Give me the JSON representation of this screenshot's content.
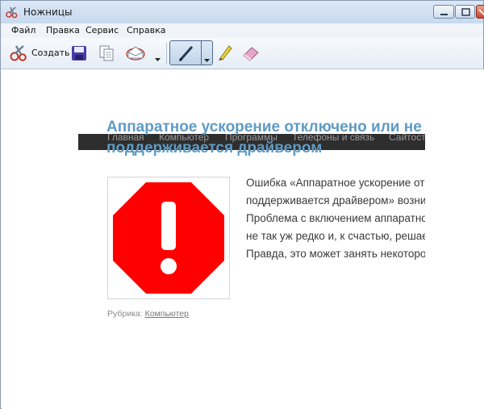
{
  "window": {
    "title": "Ножницы",
    "controls": {
      "minimize": "minimize",
      "maximize": "maximize",
      "close": "close"
    }
  },
  "menu": {
    "items": [
      "Файл",
      "Правка",
      "Сервис",
      "Справка"
    ]
  },
  "toolbar": {
    "new_label": "Создать",
    "icons": [
      "scissors-icon",
      "save-icon",
      "copy-icon",
      "send-email-icon",
      "pen-icon",
      "highlighter-icon",
      "eraser-icon"
    ]
  },
  "snip": {
    "nav": [
      "Главная",
      "Компьютер",
      "Программы",
      "Телефоны и связь",
      "Сайтостр"
    ],
    "title_lines": [
      "Аппаратное ускорение отключено или не",
      "поддерживается драйвером"
    ],
    "body_lines": [
      "Ошибка «Аппаратное ускорение отключено",
      "поддерживается драйвером» возникает",
      "Проблема с включением аппаратного",
      "не так уж редко и, к счастью, решается",
      "Правда, это может занять некоторое время"
    ],
    "rubric_label": "Рубрика:",
    "rubric_link": "Компьютер"
  },
  "colors": {
    "title_blue": "#5f9bc4",
    "stop_sign_red": "#ff0000",
    "nav_dark": "#2e2e2e"
  }
}
